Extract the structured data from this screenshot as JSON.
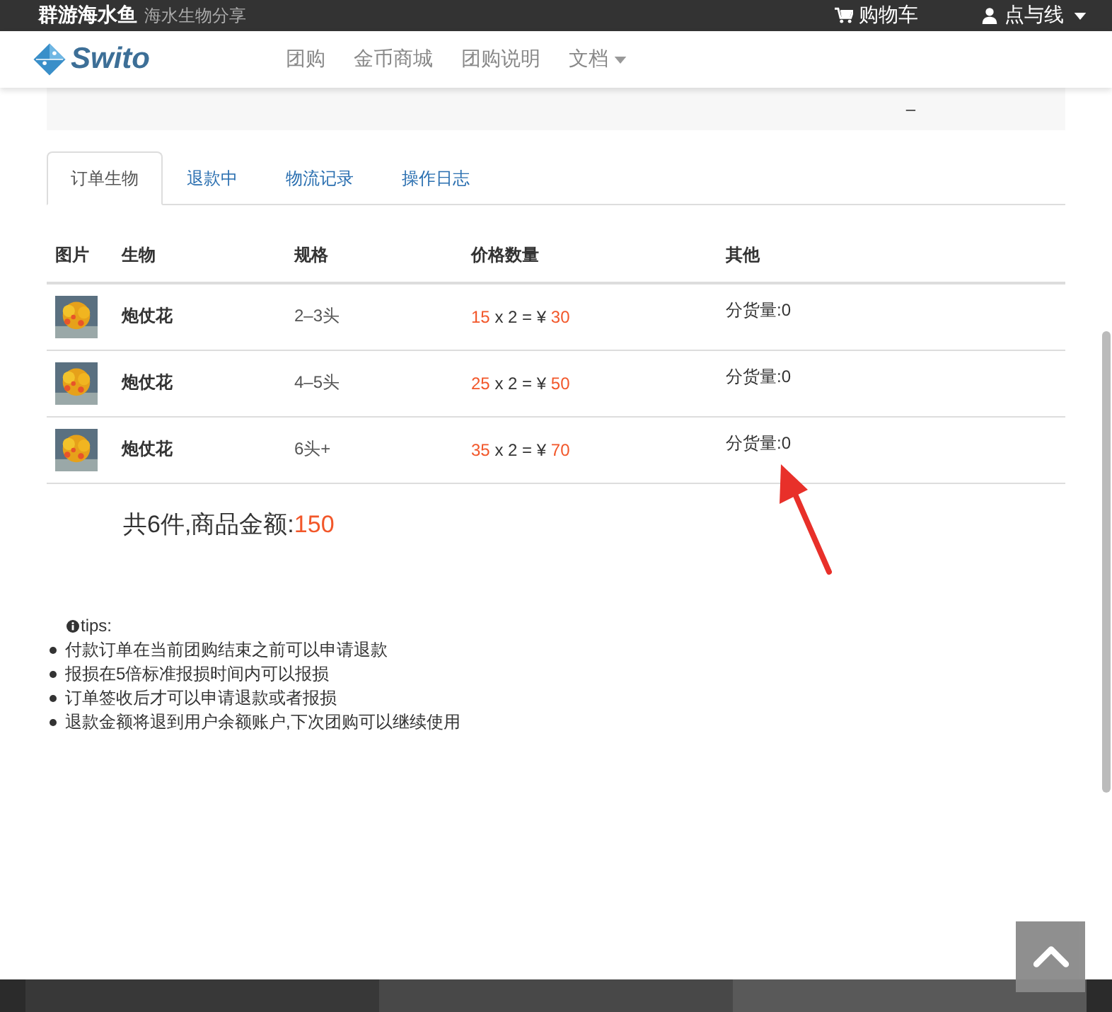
{
  "topbar": {
    "site_name": "群游海水鱼",
    "tagline": "海水生物分享",
    "cart": "购物车",
    "user": "点与线"
  },
  "navbar": {
    "logo_text": "Swito",
    "links": [
      {
        "label": "团购",
        "dropdown": false
      },
      {
        "label": "金币商城",
        "dropdown": false
      },
      {
        "label": "团购说明",
        "dropdown": false
      },
      {
        "label": "文档",
        "dropdown": true
      }
    ]
  },
  "status_panel": {
    "dash": "–"
  },
  "tabs": [
    {
      "label": "订单生物",
      "selected": true
    },
    {
      "label": "退款中",
      "selected": false
    },
    {
      "label": "物流记录",
      "selected": false
    },
    {
      "label": "操作日志",
      "selected": false
    }
  ],
  "table": {
    "columns": [
      "图片",
      "生物",
      "规格",
      "价格数量",
      "其他"
    ],
    "rows": [
      {
        "name": "炮仗花",
        "spec": "2–3头",
        "unit_price": "15",
        "middle": "x 2 = ¥",
        "total": "30",
        "other": "分货量:0"
      },
      {
        "name": "炮仗花",
        "spec": "4–5头",
        "unit_price": "25",
        "middle": "x 2 = ¥",
        "total": "50",
        "other": "分货量:0"
      },
      {
        "name": "炮仗花",
        "spec": "6头+",
        "unit_price": "35",
        "middle": "x 2 = ¥",
        "total": "70",
        "other": "分货量:0"
      }
    ]
  },
  "summary": {
    "label": "共6件,商品金额:",
    "amount": "150"
  },
  "tips": {
    "title": "tips:",
    "items": [
      "付款订单在当前团购结束之前可以申请退款",
      "报损在5倍标准报损时间内可以报损",
      "订单签收后才可以申请退款或者报损",
      "退款金额将退到用户余额账户,下次团购可以继续使用"
    ]
  }
}
